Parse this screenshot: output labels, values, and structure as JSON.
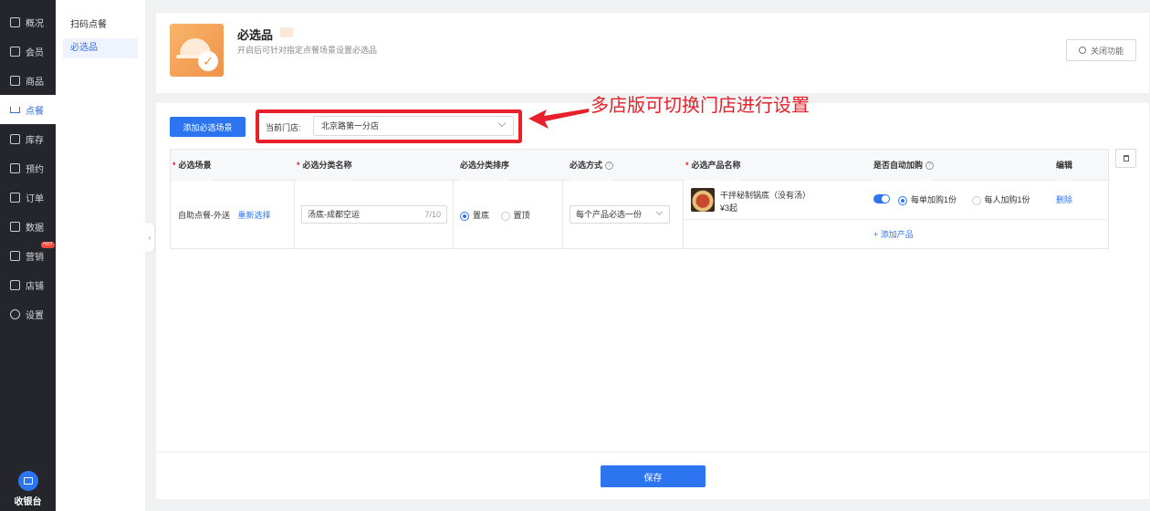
{
  "nav": {
    "items": [
      {
        "label": "概况",
        "icon": "grid-icon"
      },
      {
        "label": "会员",
        "icon": "crown-icon"
      },
      {
        "label": "商品",
        "icon": "shop-icon"
      },
      {
        "label": "点餐",
        "icon": "dish-icon"
      },
      {
        "label": "库存",
        "icon": "inventory-icon"
      },
      {
        "label": "预约",
        "icon": "calendar-check-icon"
      },
      {
        "label": "订单",
        "icon": "order-list-icon"
      },
      {
        "label": "数据",
        "icon": "data-chart-icon"
      },
      {
        "label": "营销",
        "icon": "marketing-icon"
      },
      {
        "label": "店铺",
        "icon": "store-icon"
      },
      {
        "label": "设置",
        "icon": "settings-icon"
      }
    ],
    "active_index": 3,
    "hot_badge": "HOT",
    "cashier_label": "收银台"
  },
  "subnav": {
    "group_title": "扫码点餐",
    "active_item": "必选品"
  },
  "header": {
    "title": "必选品",
    "description": "开启后可针对指定点餐场景设置必选品",
    "close_button": "关闭功能"
  },
  "toolbar": {
    "add_button": "添加必选场景",
    "store_label": "当前门店:",
    "store_value": "北京路第一分店",
    "annotation": "多店版可切换门店进行设置"
  },
  "table": {
    "columns": [
      {
        "label": "必选场景",
        "required": true
      },
      {
        "label": "必选分类名称",
        "required": true
      },
      {
        "label": "必选分类排序",
        "required": false
      },
      {
        "label": "必选方式",
        "required": false,
        "help": true
      },
      {
        "label": "必选产品名称",
        "required": true
      },
      {
        "label": "是否自动加购",
        "required": false,
        "help": true
      },
      {
        "label": "编辑",
        "required": false
      }
    ],
    "row": {
      "scene": "自助点餐-外送",
      "reselect_link": "重新选择",
      "category_name": "汤底-成都空运",
      "category_count": "7/10",
      "sort_options": [
        "置底",
        "置顶"
      ],
      "sort_selected": "置底",
      "method": "每个产品必选一份",
      "product_name": "干拌秘制锅底（没有汤）",
      "product_price": "¥3起",
      "auto_add_enabled": true,
      "auto_add_options": [
        "每单加购1份",
        "每人加购1份"
      ],
      "auto_add_selected": "每单加购1份",
      "delete_link": "删除",
      "add_product_link": "+ 添加产品"
    }
  },
  "footer": {
    "save_button": "保存"
  }
}
